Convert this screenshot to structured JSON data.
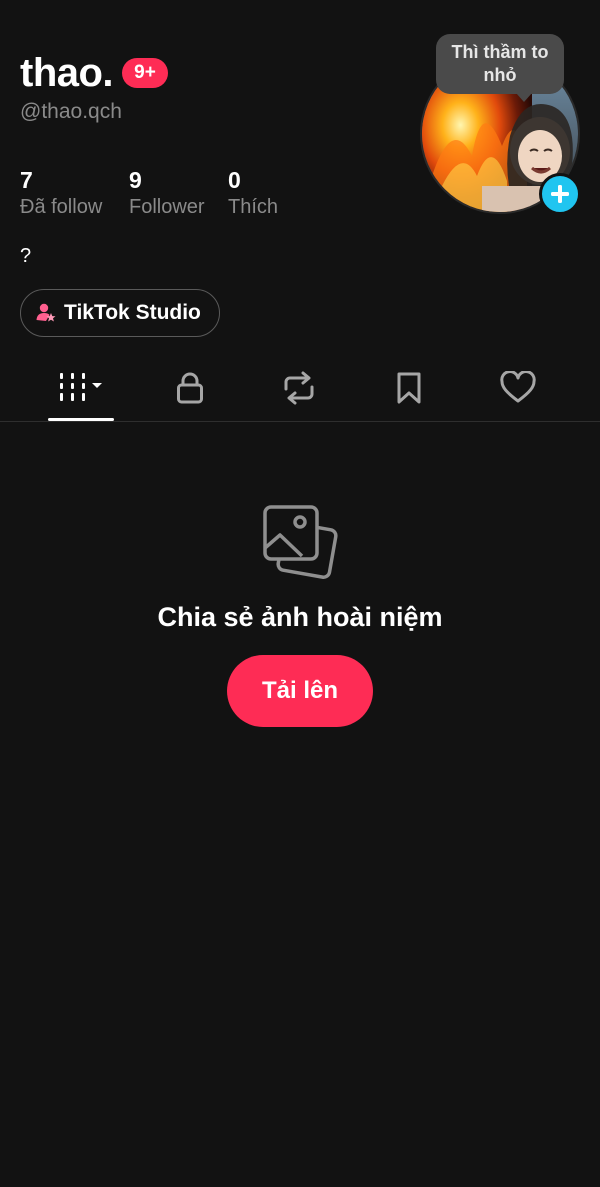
{
  "profile": {
    "display_name": "thao.",
    "badge": "9+",
    "username": "@thao.qch",
    "bio": "?",
    "avatar_bubble": "Thì thầm to nhỏ"
  },
  "stats": [
    {
      "value": "7",
      "label": "Đã follow"
    },
    {
      "value": "9",
      "label": "Follower"
    },
    {
      "value": "0",
      "label": "Thích"
    }
  ],
  "studio_button": {
    "label": "TikTok Studio",
    "icon": "studio-person-star-icon"
  },
  "tabs": [
    {
      "icon": "grid-icon",
      "active": true
    },
    {
      "icon": "lock-icon",
      "active": false
    },
    {
      "icon": "repost-icon",
      "active": false
    },
    {
      "icon": "bookmark-icon",
      "active": false
    },
    {
      "icon": "heart-icon",
      "active": false
    }
  ],
  "empty_state": {
    "icon": "photos-icon",
    "title": "Chia sẻ ảnh hoài niệm",
    "button_label": "Tải lên"
  },
  "colors": {
    "background": "#121212",
    "accent": "#fe2c55",
    "add_button": "#20c5f0",
    "secondary_text": "#8a8a8a",
    "icon_gray": "#a6a6a6"
  }
}
